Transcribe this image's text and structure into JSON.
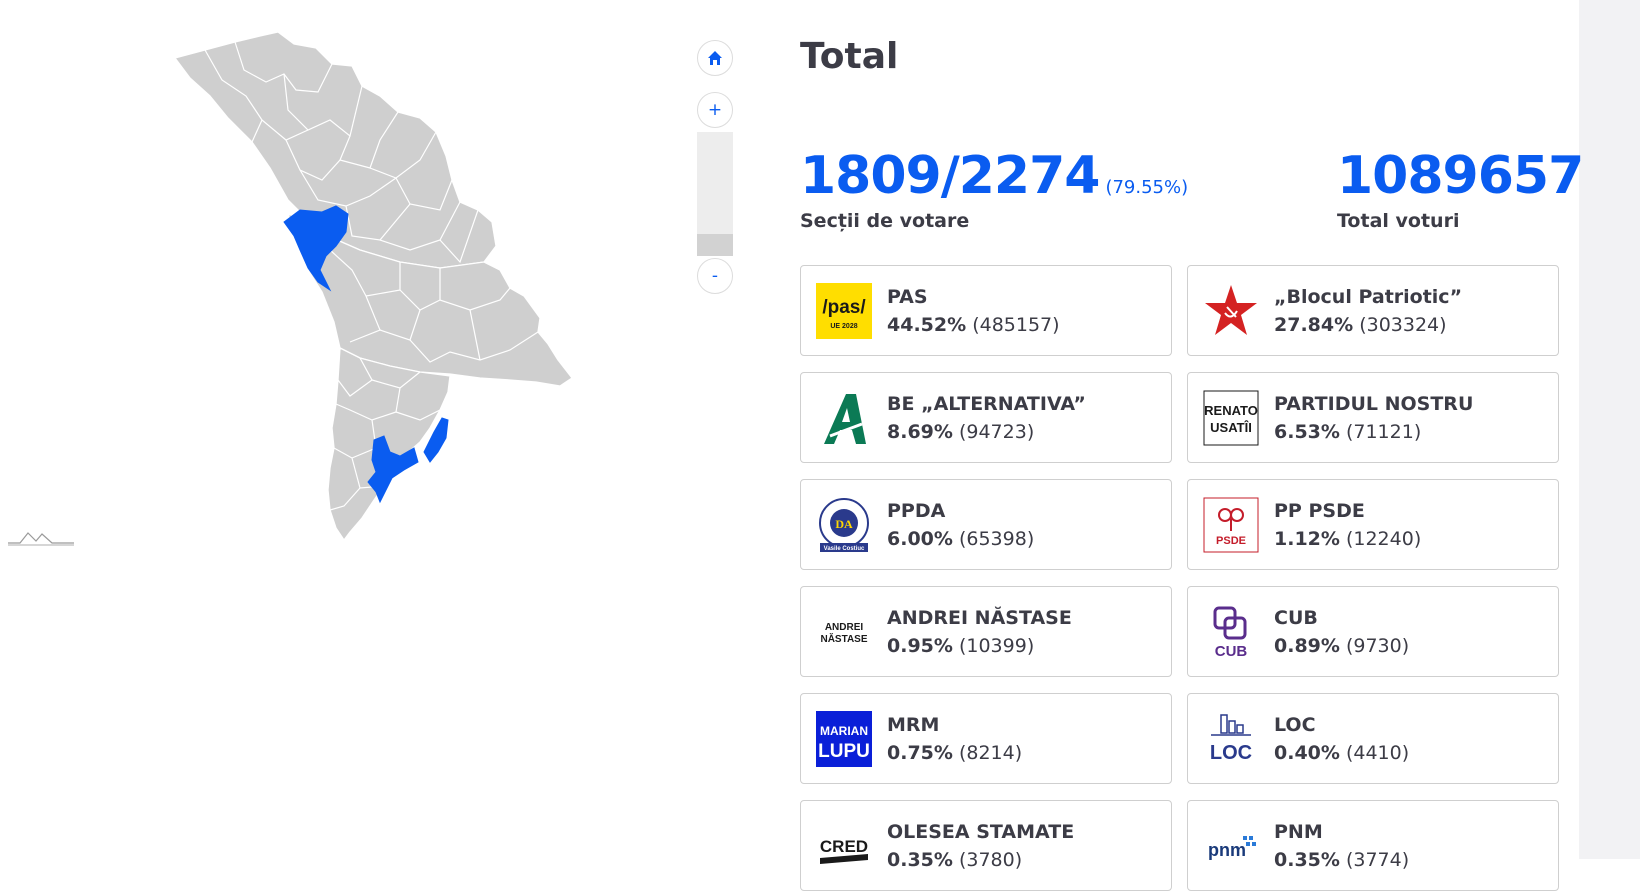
{
  "controls": {
    "home_label": "⌂",
    "zoom_in": "+",
    "zoom_out": "-"
  },
  "header": {
    "title": "Total"
  },
  "stats": {
    "sections_counted": "1809/2274",
    "sections_percent": "(79.55%)",
    "sections_label": "Secții de votare",
    "total_votes": "1089657",
    "total_votes_label": "Total voturi"
  },
  "colors": {
    "accent": "#0a5cf0",
    "map_fill": "#cfcfcf",
    "map_highlight": "#0a5cf0"
  },
  "parties": [
    {
      "name": "PAS",
      "percent": "44.52%",
      "votes": "(485157)",
      "logo": "pas-logo",
      "logo_text": "/pas/",
      "logo_sub": "UE 2028"
    },
    {
      "name": "„Blocul Patriotic”",
      "percent": "27.84%",
      "votes": "(303324)",
      "logo": "star-hammer-sickle-logo"
    },
    {
      "name": "BE „ALTERNATIVA”",
      "percent": "8.69%",
      "votes": "(94723)",
      "logo": "alternativa-logo"
    },
    {
      "name": "PARTIDUL NOSTRU",
      "percent": "6.53%",
      "votes": "(71121)",
      "logo": "renato-usatii-logo",
      "logo_text": "RENATO",
      "logo_sub": "USATÎI"
    },
    {
      "name": "PPDA",
      "percent": "6.00%",
      "votes": "(65398)",
      "logo": "ppda-logo",
      "logo_text": "DA",
      "logo_sub": "Vasile Costiuc"
    },
    {
      "name": "PP PSDE",
      "percent": "1.12%",
      "votes": "(12240)",
      "logo": "psde-logo",
      "logo_text": "PSDE"
    },
    {
      "name": "ANDREI NĂSTASE",
      "percent": "0.95%",
      "votes": "(10399)",
      "logo": "andrei-nastase-logo",
      "logo_text": "ANDREI",
      "logo_sub": "NĂSTASE"
    },
    {
      "name": "CUB",
      "percent": "0.89%",
      "votes": "(9730)",
      "logo": "cub-logo",
      "logo_text": "CUB"
    },
    {
      "name": "MRM",
      "percent": "0.75%",
      "votes": "(8214)",
      "logo": "marian-lupu-logo",
      "logo_text": "MARIAN",
      "logo_sub": "LUPU"
    },
    {
      "name": "LOC",
      "percent": "0.40%",
      "votes": "(4410)",
      "logo": "loc-logo",
      "logo_text": "LOC"
    },
    {
      "name": "OLESEA STAMATE",
      "percent": "0.35%",
      "votes": "(3780)",
      "logo": "cred-logo",
      "logo_text": "CRED"
    },
    {
      "name": "PNM",
      "percent": "0.35%",
      "votes": "(3774)",
      "logo": "pnm-logo",
      "logo_text": "pnm"
    }
  ]
}
